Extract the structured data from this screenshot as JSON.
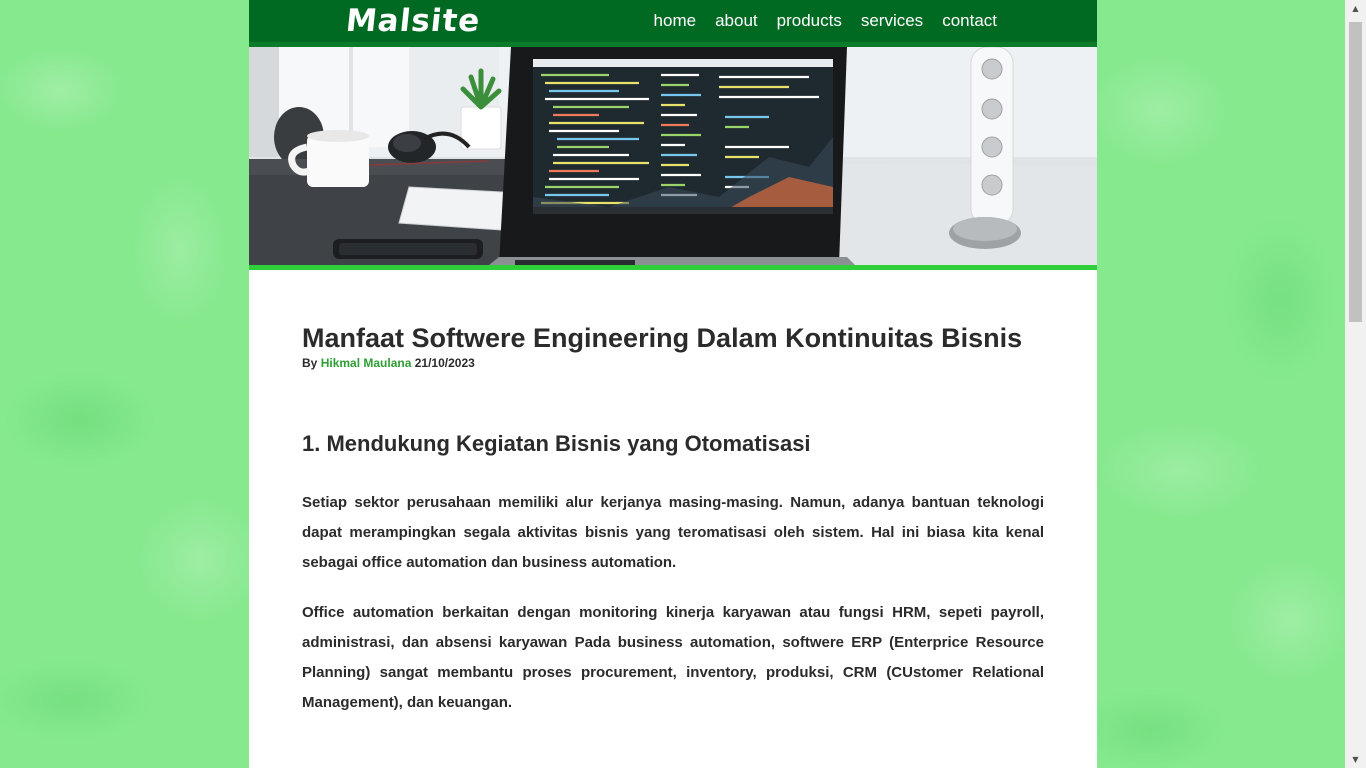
{
  "nav": {
    "logo": "Malsite",
    "items": [
      {
        "label": "home"
      },
      {
        "label": "about"
      },
      {
        "label": "products"
      },
      {
        "label": "services"
      },
      {
        "label": "contact"
      }
    ]
  },
  "colors": {
    "nav_bg": "#006a22",
    "accent": "#2fcf3a",
    "author_link": "#2e9e35",
    "page_bg": "#86e98e"
  },
  "hero": {
    "image": "laptop-with-code-on-desk"
  },
  "article": {
    "title": "Manfaat Softwere Engineering Dalam Kontinuitas Bisnis",
    "by_label": "By",
    "author": "Hikmal Maulana",
    "date": "21/10/2023",
    "section_title": "1. Mendukung Kegiatan Bisnis yang Otomatisasi",
    "paragraphs": [
      "Setiap sektor perusahaan memiliki alur kerjanya masing-masing. Namun, adanya bantuan teknologi dapat merampingkan segala aktivitas bisnis yang teromatisasi oleh sistem. Hal ini biasa kita kenal sebagai office automation dan business automation.",
      "Office automation berkaitan dengan monitoring kinerja karyawan atau fungsi HRM, sepeti payroll, administrasi, dan absensi karyawan Pada business automation, softwere ERP (Enterprice Resource Planning) sangat membantu proses procurement, inventory, produksi, CRM (CUstomer Relational Management), dan keuangan."
    ]
  },
  "scrollbar": {
    "up_icon": "arrow-up-icon",
    "down_icon": "arrow-down-icon"
  }
}
